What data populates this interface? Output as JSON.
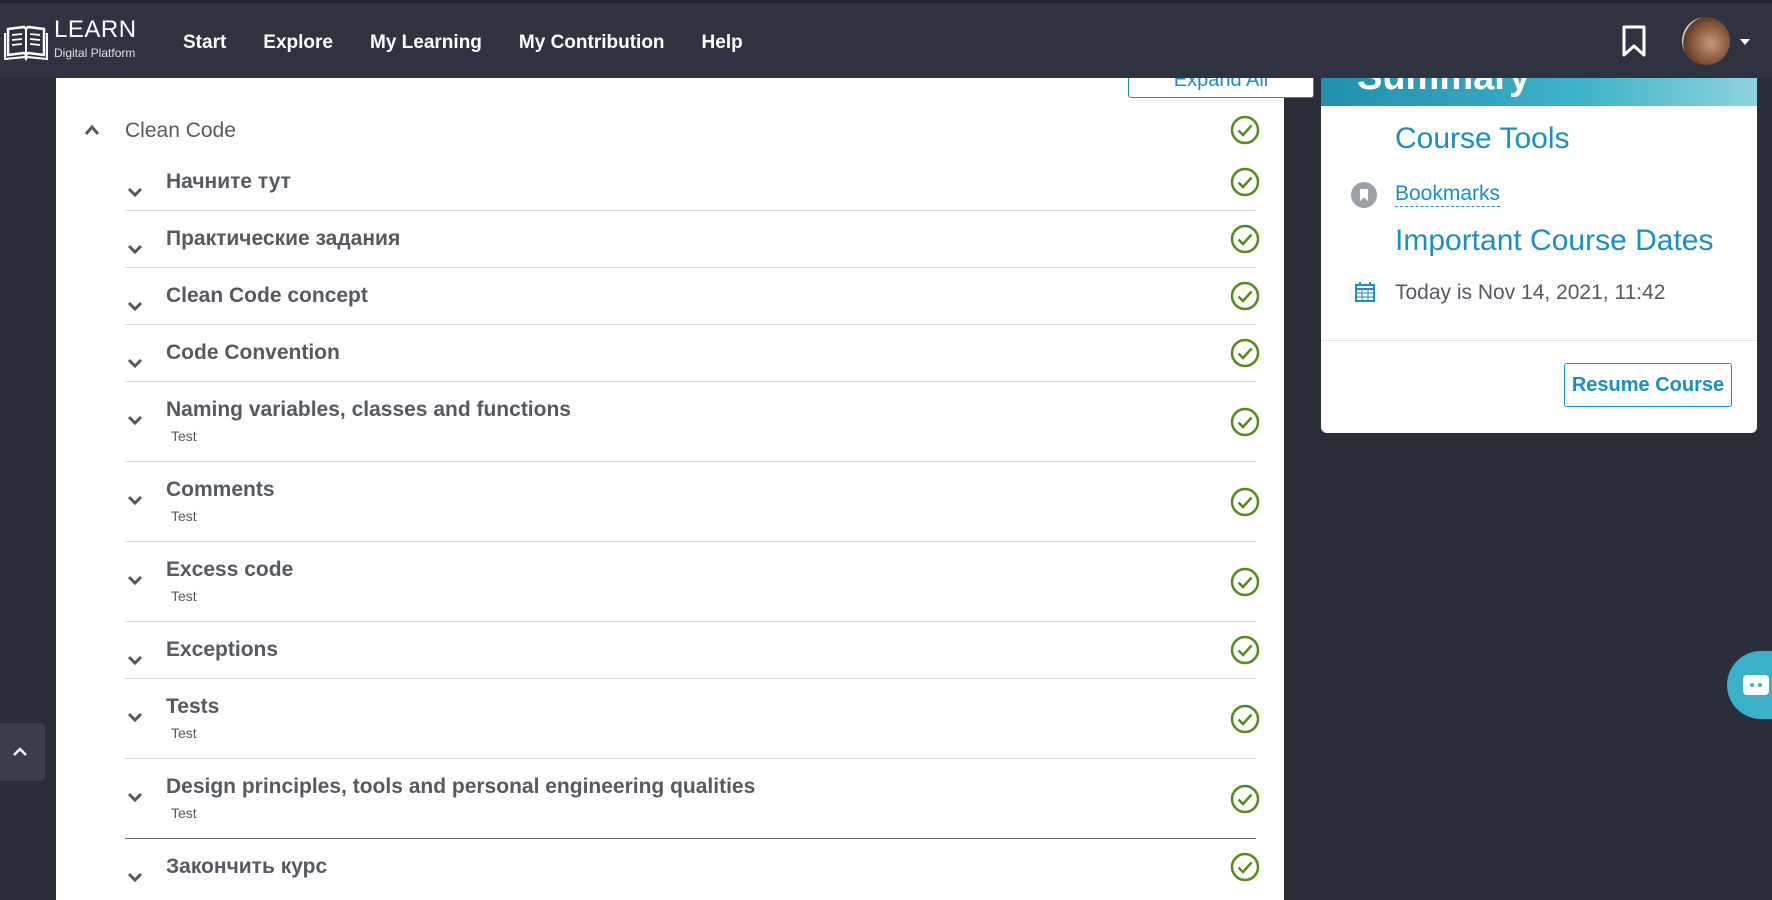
{
  "header": {
    "logo_title": "LEARN",
    "logo_subtitle": "Digital Platform",
    "nav": [
      "Start",
      "Explore",
      "My Learning",
      "My Contribution",
      "Help"
    ]
  },
  "outline": {
    "expand_all_label": "Expand All",
    "section_title": "Clean Code",
    "items": [
      {
        "title": "Начните тут",
        "sub": ""
      },
      {
        "title": "Практические задания",
        "sub": ""
      },
      {
        "title": "Clean Code concept",
        "sub": ""
      },
      {
        "title": "Code Convention",
        "sub": ""
      },
      {
        "title": "Naming variables, classes and functions",
        "sub": "Test"
      },
      {
        "title": "Comments",
        "sub": "Test"
      },
      {
        "title": "Excess code",
        "sub": "Test"
      },
      {
        "title": "Exceptions",
        "sub": ""
      },
      {
        "title": "Tests",
        "sub": "Test"
      },
      {
        "title": "Design principles, tools and personal engineering qualities",
        "sub": "Test"
      },
      {
        "title": "Закончить курс",
        "sub": ""
      }
    ]
  },
  "sidebar": {
    "banner_text": "Summary",
    "course_tools_heading": "Course Tools",
    "bookmarks_link": "Bookmarks",
    "dates_heading": "Important Course Dates",
    "today_text": "Today is Nov 14, 2021, 11:42",
    "resume_label": "Resume Course"
  },
  "colors": {
    "accent": "#1a8fc3",
    "complete_green": "#5a8a1a",
    "header_bg": "#2f3340",
    "page_bg": "#2a2e39"
  },
  "icons": {
    "logo": "book-icon",
    "header_bookmark": "bookmark-outline-icon",
    "complete": "check-circle-icon",
    "row_toggle": "chevron-down-icon",
    "section_toggle": "chevron-up-icon",
    "bookmarks": "bookmark-icon",
    "dates": "calendar-icon",
    "scroll_top": "chevron-up-icon",
    "chat": "chat-icon"
  }
}
